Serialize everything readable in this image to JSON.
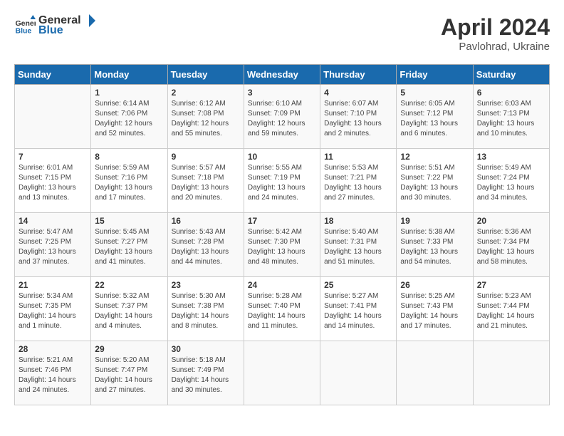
{
  "logo": {
    "general": "General",
    "blue": "Blue"
  },
  "title": {
    "month": "April 2024",
    "location": "Pavlohrad, Ukraine"
  },
  "headers": [
    "Sunday",
    "Monday",
    "Tuesday",
    "Wednesday",
    "Thursday",
    "Friday",
    "Saturday"
  ],
  "weeks": [
    [
      {
        "day": "",
        "info": ""
      },
      {
        "day": "1",
        "info": "Sunrise: 6:14 AM\nSunset: 7:06 PM\nDaylight: 12 hours\nand 52 minutes."
      },
      {
        "day": "2",
        "info": "Sunrise: 6:12 AM\nSunset: 7:08 PM\nDaylight: 12 hours\nand 55 minutes."
      },
      {
        "day": "3",
        "info": "Sunrise: 6:10 AM\nSunset: 7:09 PM\nDaylight: 12 hours\nand 59 minutes."
      },
      {
        "day": "4",
        "info": "Sunrise: 6:07 AM\nSunset: 7:10 PM\nDaylight: 13 hours\nand 2 minutes."
      },
      {
        "day": "5",
        "info": "Sunrise: 6:05 AM\nSunset: 7:12 PM\nDaylight: 13 hours\nand 6 minutes."
      },
      {
        "day": "6",
        "info": "Sunrise: 6:03 AM\nSunset: 7:13 PM\nDaylight: 13 hours\nand 10 minutes."
      }
    ],
    [
      {
        "day": "7",
        "info": "Sunrise: 6:01 AM\nSunset: 7:15 PM\nDaylight: 13 hours\nand 13 minutes."
      },
      {
        "day": "8",
        "info": "Sunrise: 5:59 AM\nSunset: 7:16 PM\nDaylight: 13 hours\nand 17 minutes."
      },
      {
        "day": "9",
        "info": "Sunrise: 5:57 AM\nSunset: 7:18 PM\nDaylight: 13 hours\nand 20 minutes."
      },
      {
        "day": "10",
        "info": "Sunrise: 5:55 AM\nSunset: 7:19 PM\nDaylight: 13 hours\nand 24 minutes."
      },
      {
        "day": "11",
        "info": "Sunrise: 5:53 AM\nSunset: 7:21 PM\nDaylight: 13 hours\nand 27 minutes."
      },
      {
        "day": "12",
        "info": "Sunrise: 5:51 AM\nSunset: 7:22 PM\nDaylight: 13 hours\nand 30 minutes."
      },
      {
        "day": "13",
        "info": "Sunrise: 5:49 AM\nSunset: 7:24 PM\nDaylight: 13 hours\nand 34 minutes."
      }
    ],
    [
      {
        "day": "14",
        "info": "Sunrise: 5:47 AM\nSunset: 7:25 PM\nDaylight: 13 hours\nand 37 minutes."
      },
      {
        "day": "15",
        "info": "Sunrise: 5:45 AM\nSunset: 7:27 PM\nDaylight: 13 hours\nand 41 minutes."
      },
      {
        "day": "16",
        "info": "Sunrise: 5:43 AM\nSunset: 7:28 PM\nDaylight: 13 hours\nand 44 minutes."
      },
      {
        "day": "17",
        "info": "Sunrise: 5:42 AM\nSunset: 7:30 PM\nDaylight: 13 hours\nand 48 minutes."
      },
      {
        "day": "18",
        "info": "Sunrise: 5:40 AM\nSunset: 7:31 PM\nDaylight: 13 hours\nand 51 minutes."
      },
      {
        "day": "19",
        "info": "Sunrise: 5:38 AM\nSunset: 7:33 PM\nDaylight: 13 hours\nand 54 minutes."
      },
      {
        "day": "20",
        "info": "Sunrise: 5:36 AM\nSunset: 7:34 PM\nDaylight: 13 hours\nand 58 minutes."
      }
    ],
    [
      {
        "day": "21",
        "info": "Sunrise: 5:34 AM\nSunset: 7:35 PM\nDaylight: 14 hours\nand 1 minute."
      },
      {
        "day": "22",
        "info": "Sunrise: 5:32 AM\nSunset: 7:37 PM\nDaylight: 14 hours\nand 4 minutes."
      },
      {
        "day": "23",
        "info": "Sunrise: 5:30 AM\nSunset: 7:38 PM\nDaylight: 14 hours\nand 8 minutes."
      },
      {
        "day": "24",
        "info": "Sunrise: 5:28 AM\nSunset: 7:40 PM\nDaylight: 14 hours\nand 11 minutes."
      },
      {
        "day": "25",
        "info": "Sunrise: 5:27 AM\nSunset: 7:41 PM\nDaylight: 14 hours\nand 14 minutes."
      },
      {
        "day": "26",
        "info": "Sunrise: 5:25 AM\nSunset: 7:43 PM\nDaylight: 14 hours\nand 17 minutes."
      },
      {
        "day": "27",
        "info": "Sunrise: 5:23 AM\nSunset: 7:44 PM\nDaylight: 14 hours\nand 21 minutes."
      }
    ],
    [
      {
        "day": "28",
        "info": "Sunrise: 5:21 AM\nSunset: 7:46 PM\nDaylight: 14 hours\nand 24 minutes."
      },
      {
        "day": "29",
        "info": "Sunrise: 5:20 AM\nSunset: 7:47 PM\nDaylight: 14 hours\nand 27 minutes."
      },
      {
        "day": "30",
        "info": "Sunrise: 5:18 AM\nSunset: 7:49 PM\nDaylight: 14 hours\nand 30 minutes."
      },
      {
        "day": "",
        "info": ""
      },
      {
        "day": "",
        "info": ""
      },
      {
        "day": "",
        "info": ""
      },
      {
        "day": "",
        "info": ""
      }
    ]
  ]
}
